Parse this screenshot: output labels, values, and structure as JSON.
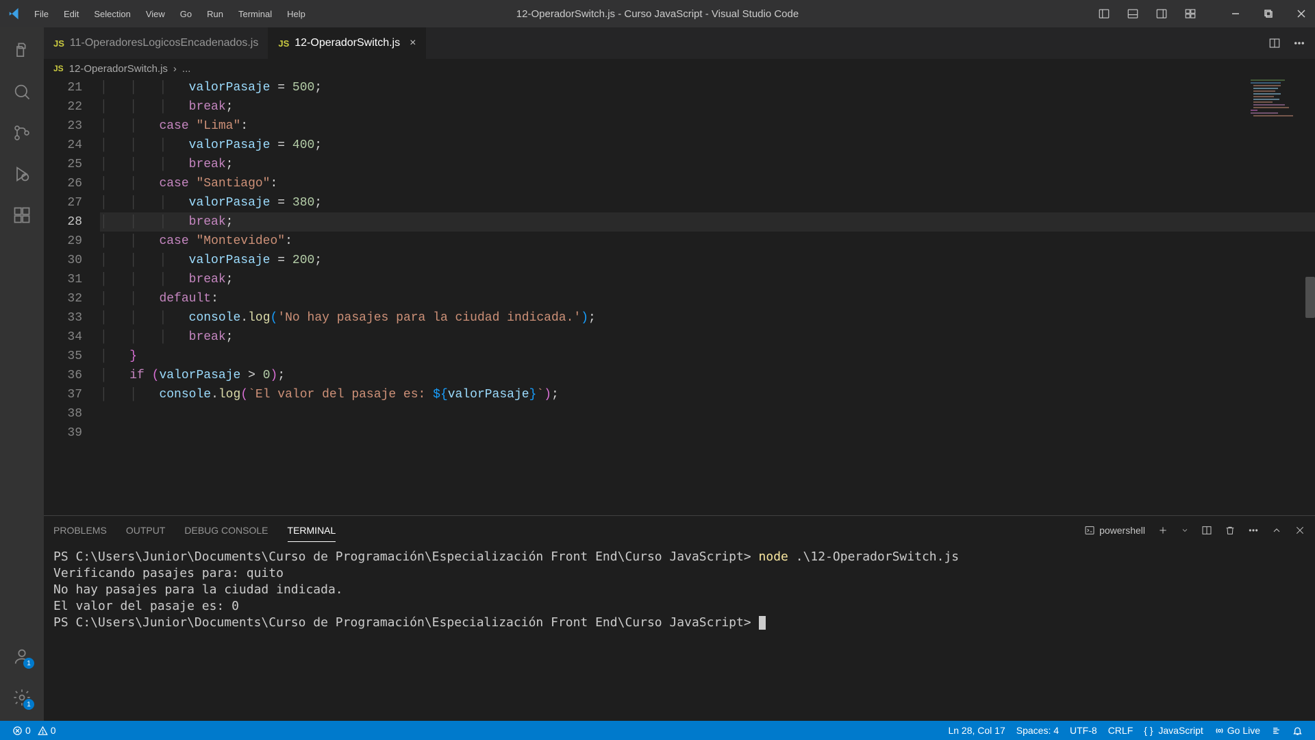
{
  "titleBar": {
    "menu": [
      "File",
      "Edit",
      "Selection",
      "View",
      "Go",
      "Run",
      "Terminal",
      "Help"
    ],
    "title": "12-OperadorSwitch.js - Curso JavaScript - Visual Studio Code"
  },
  "activityBar": {
    "accountBadge": "1",
    "settingsBadge": "1"
  },
  "tabs": [
    {
      "label": "11-OperadoresLogicosEncadenados.js",
      "active": false
    },
    {
      "label": "12-OperadorSwitch.js",
      "active": true
    }
  ],
  "breadcrumb": {
    "file": "12-OperadorSwitch.js",
    "rest": "..."
  },
  "code": {
    "start": 21,
    "currentLine": 28,
    "lines": [
      [
        [
          "pad",
          "            "
        ],
        [
          "ident",
          "valorPasaje"
        ],
        [
          "op",
          " = "
        ],
        [
          "num",
          "500"
        ],
        [
          "punc",
          ";"
        ]
      ],
      [
        [
          "pad",
          "            "
        ],
        [
          "key",
          "break"
        ],
        [
          "punc",
          ";"
        ]
      ],
      [
        [
          "pad",
          "        "
        ],
        [
          "key",
          "case"
        ],
        [
          "op",
          " "
        ],
        [
          "str",
          "\"Lima\""
        ],
        [
          "punc",
          ":"
        ]
      ],
      [
        [
          "pad",
          "            "
        ],
        [
          "ident",
          "valorPasaje"
        ],
        [
          "op",
          " = "
        ],
        [
          "num",
          "400"
        ],
        [
          "punc",
          ";"
        ]
      ],
      [
        [
          "pad",
          "            "
        ],
        [
          "key",
          "break"
        ],
        [
          "punc",
          ";"
        ]
      ],
      [
        [
          "pad",
          "        "
        ],
        [
          "key",
          "case"
        ],
        [
          "op",
          " "
        ],
        [
          "str",
          "\"Santiago\""
        ],
        [
          "punc",
          ":"
        ]
      ],
      [
        [
          "pad",
          "            "
        ],
        [
          "ident",
          "valorPasaje"
        ],
        [
          "op",
          " = "
        ],
        [
          "num",
          "380"
        ],
        [
          "punc",
          ";"
        ]
      ],
      [
        [
          "pad",
          "            "
        ],
        [
          "key",
          "break"
        ],
        [
          "punc",
          ";"
        ]
      ],
      [
        [
          "pad",
          "        "
        ],
        [
          "key",
          "case"
        ],
        [
          "op",
          " "
        ],
        [
          "str",
          "\"Montevideo\""
        ],
        [
          "punc",
          ":"
        ]
      ],
      [
        [
          "pad",
          "            "
        ],
        [
          "ident",
          "valorPasaje"
        ],
        [
          "op",
          " = "
        ],
        [
          "num",
          "200"
        ],
        [
          "punc",
          ";"
        ]
      ],
      [
        [
          "pad",
          "            "
        ],
        [
          "key",
          "break"
        ],
        [
          "punc",
          ";"
        ]
      ],
      [
        [
          "pad",
          "        "
        ],
        [
          "key",
          "default"
        ],
        [
          "punc",
          ":"
        ]
      ],
      [
        [
          "pad",
          "            "
        ],
        [
          "ident",
          "console"
        ],
        [
          "punc",
          "."
        ],
        [
          "func",
          "log"
        ],
        [
          "brace2",
          "("
        ],
        [
          "str",
          "'No hay pasajes para la ciudad indicada.'"
        ],
        [
          "brace2",
          ")"
        ],
        [
          "punc",
          ";"
        ]
      ],
      [
        [
          "pad",
          "            "
        ],
        [
          "key",
          "break"
        ],
        [
          "punc",
          ";"
        ]
      ],
      [
        [
          "pad",
          "    "
        ],
        [
          "brace1",
          "}"
        ]
      ],
      [
        [
          "pad",
          "    "
        ],
        [
          "key",
          "if"
        ],
        [
          "op",
          " "
        ],
        [
          "brace1",
          "("
        ],
        [
          "ident",
          "valorPasaje"
        ],
        [
          "op",
          " > "
        ],
        [
          "num",
          "0"
        ],
        [
          "brace1",
          ")"
        ],
        [
          "punc",
          ";"
        ]
      ],
      [
        [
          "pad",
          "        "
        ],
        [
          "ident",
          "console"
        ],
        [
          "punc",
          "."
        ],
        [
          "func",
          "log"
        ],
        [
          "brace1",
          "("
        ],
        [
          "str",
          "`El valor del pasaje es: "
        ],
        [
          "brace2",
          "${"
        ],
        [
          "ident",
          "valorPasaje"
        ],
        [
          "brace2",
          "}"
        ],
        [
          "str",
          "`"
        ],
        [
          "brace1",
          ")"
        ],
        [
          "punc",
          ";"
        ]
      ],
      [
        [
          "pad",
          ""
        ]
      ],
      [
        [
          "pad",
          ""
        ]
      ]
    ]
  },
  "panel": {
    "tabs": [
      "PROBLEMS",
      "OUTPUT",
      "DEBUG CONSOLE",
      "TERMINAL"
    ],
    "activeTab": "TERMINAL",
    "shell": "powershell",
    "lines": [
      {
        "prompt": "PS C:\\Users\\Junior\\Documents\\Curso de Programación\\Especialización Front End\\Curso JavaScript> ",
        "cmd": "node",
        "args": " .\\12-OperadorSwitch.js"
      },
      {
        "text": "Verificando pasajes para: quito"
      },
      {
        "text": "No hay pasajes para la ciudad indicada."
      },
      {
        "text": "El valor del pasaje es: 0"
      },
      {
        "prompt": "PS C:\\Users\\Junior\\Documents\\Curso de Programación\\Especialización Front End\\Curso JavaScript> ",
        "cursor": true
      }
    ]
  },
  "status": {
    "errors": "0",
    "warnings": "0",
    "cursor": "Ln 28, Col 17",
    "spaces": "Spaces: 4",
    "encoding": "UTF-8",
    "eol": "CRLF",
    "lang": "JavaScript",
    "golive": "Go Live"
  }
}
